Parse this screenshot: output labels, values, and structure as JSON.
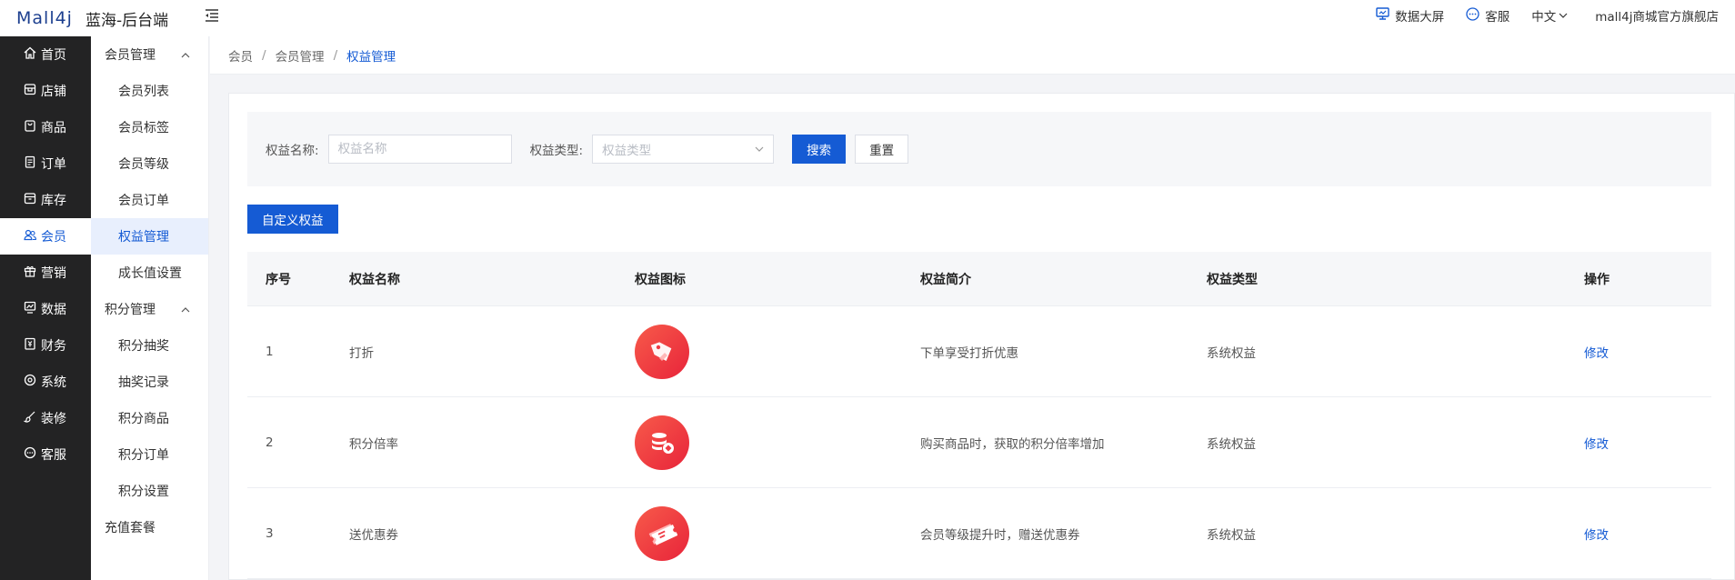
{
  "header": {
    "logo": "Mall4j",
    "app_title": "蓝海-后台端",
    "actions": [
      {
        "label": "数据大屏",
        "icon": "monitor-icon"
      },
      {
        "label": "客服",
        "icon": "chat-icon"
      }
    ],
    "language": "中文",
    "store_name": "mall4j商城官方旗舰店"
  },
  "primary_nav": [
    {
      "label": "首页",
      "icon": "home-icon"
    },
    {
      "label": "店铺",
      "icon": "store-icon"
    },
    {
      "label": "商品",
      "icon": "bag-icon"
    },
    {
      "label": "订单",
      "icon": "document-icon"
    },
    {
      "label": "库存",
      "icon": "box-icon"
    },
    {
      "label": "会员",
      "icon": "users-icon",
      "active": true
    },
    {
      "label": "营销",
      "icon": "gift-icon"
    },
    {
      "label": "数据",
      "icon": "chart-icon"
    },
    {
      "label": "财务",
      "icon": "finance-icon"
    },
    {
      "label": "系统",
      "icon": "settings-icon"
    },
    {
      "label": "装修",
      "icon": "brush-icon"
    },
    {
      "label": "客服",
      "icon": "chat-icon"
    }
  ],
  "secondary_nav": {
    "group1": {
      "label": "会员管理",
      "items": [
        "会员列表",
        "会员标签",
        "会员等级",
        "会员订单",
        "权益管理",
        "成长值设置"
      ]
    },
    "group2": {
      "label": "积分管理",
      "items": [
        "积分抽奖",
        "抽奖记录",
        "积分商品",
        "积分订单",
        "积分设置"
      ]
    },
    "single": "充值套餐"
  },
  "breadcrumb": [
    "会员",
    "会员管理",
    "权益管理"
  ],
  "filter": {
    "name_label": "权益名称:",
    "name_placeholder": "权益名称",
    "type_label": "权益类型:",
    "type_placeholder": "权益类型",
    "search_button": "搜索",
    "reset_button": "重置"
  },
  "add_button": "自定义权益",
  "table": {
    "headers": [
      "序号",
      "权益名称",
      "权益图标",
      "权益简介",
      "权益类型",
      "操作"
    ],
    "rows": [
      {
        "no": "1",
        "name": "打折",
        "icon": "tag-icon",
        "desc": "下单享受打折优惠",
        "type": "系统权益",
        "action": "修改"
      },
      {
        "no": "2",
        "name": "积分倍率",
        "icon": "coins-icon",
        "desc": "购买商品时，获取的积分倍率增加",
        "type": "系统权益",
        "action": "修改"
      },
      {
        "no": "3",
        "name": "送优惠券",
        "icon": "coupon-icon",
        "desc": "会员等级提升时，赠送优惠券",
        "type": "系统权益",
        "action": "修改"
      }
    ]
  },
  "colors": {
    "primary": "#155bd4",
    "sidebar_bg": "#232324",
    "icon_red": "#e8243a"
  }
}
